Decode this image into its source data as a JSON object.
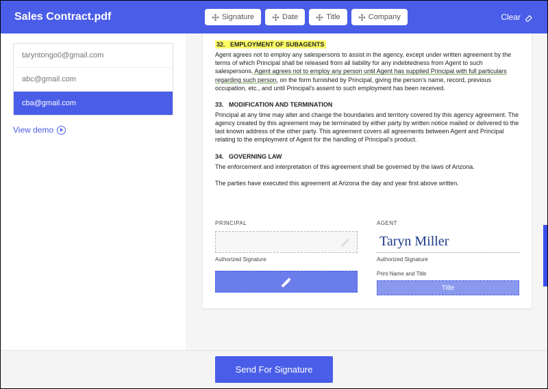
{
  "header": {
    "title": "Sales Contract.pdf",
    "pills": [
      "Signature",
      "Date",
      "Title",
      "Company"
    ],
    "clear": "Clear"
  },
  "sidebar": {
    "emails": [
      "taryntongo0@gmail.com",
      "abc@gmail.com",
      "cba@gmail.com"
    ],
    "activeIndex": 2,
    "viewDemo": "View demo"
  },
  "document": {
    "sec32_num": "32.",
    "sec32_title": "EMPLOYMENT OF SUBAGENTS",
    "sec32_body_a": "Agent agrees not to employ any salespersons to assist in the agency, except under written agreement by the terms of which Principal shall be released from all liability for any indebtedness from Agent to such salespersons.",
    "sec32_body_b": " Agent agrees not to employ any person until Agent has supplied Principal with full particulars regarding such person,",
    "sec32_body_c": " on the form furnished by Principal, giving the person's name, record, previous occupation, etc., and until Principal's assent to such employment has been received.",
    "sec33_num": "33.",
    "sec33_title": "MODIFICATION AND TERMINATION",
    "sec33_body": "Principal at any time may alter and change the boundaries and territory covered by this agency agreement. The agency created by this agreement may be terminated by either party by written notice mailed or delivered to the last known address of the other party. This agreement covers all agreements between Agent and Principal relating to the employment of Agent for the handling of Principal's product.",
    "sec34_num": "34.",
    "sec34_title": "GOVERNING LAW",
    "sec34_body1": "The enforcement and interpretation of this agreement shall be governed by the laws of Arizona.",
    "sec34_body2": "The parties have executed this agreement at Arizona the day and year first above written.",
    "principal_label": "PRINCIPAL",
    "agent_label": "AGENT",
    "authorized": "Authorized Signature",
    "print_name": "Print Name and Title",
    "title_placeholder": "Title",
    "agent_signature": "Taryn Miller"
  },
  "footer": {
    "send": "Send For Signature"
  }
}
